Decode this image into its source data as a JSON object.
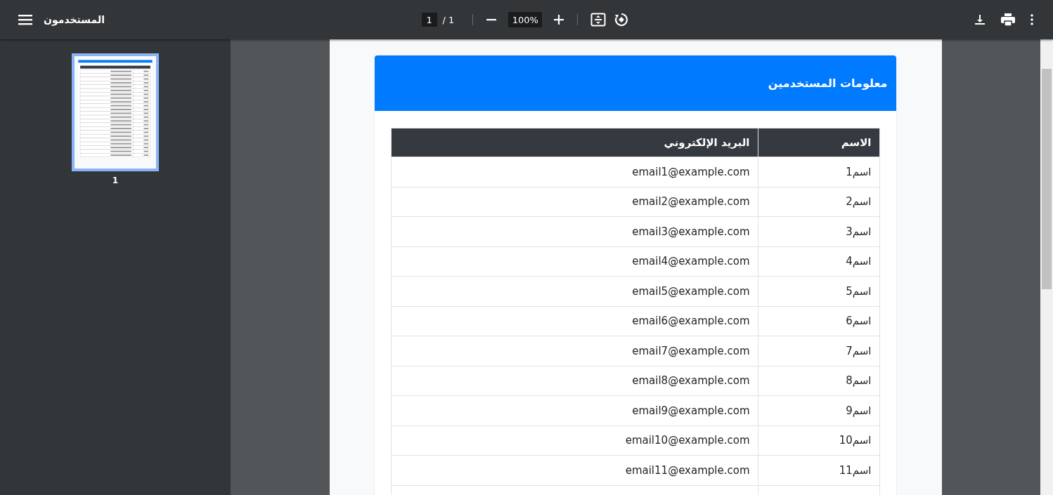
{
  "toolbar": {
    "title": "المستخدمون",
    "page_input": "1",
    "page_total": "/ 1",
    "zoom": "100%"
  },
  "thumbnails": [
    {
      "label": "1",
      "selected": true
    }
  ],
  "document": {
    "card_title": "معلومات المستخدمين",
    "table": {
      "columns": [
        "الاسم",
        "البريد الإلكتروني"
      ],
      "rows": [
        [
          "اسم1",
          "email1@example.com"
        ],
        [
          "اسم2",
          "email2@example.com"
        ],
        [
          "اسم3",
          "email3@example.com"
        ],
        [
          "اسم4",
          "email4@example.com"
        ],
        [
          "اسم5",
          "email5@example.com"
        ],
        [
          "اسم6",
          "email6@example.com"
        ],
        [
          "اسم7",
          "email7@example.com"
        ],
        [
          "اسم8",
          "email8@example.com"
        ],
        [
          "اسم9",
          "email9@example.com"
        ],
        [
          "اسم10",
          "email10@example.com"
        ],
        [
          "اسم11",
          "email11@example.com"
        ]
      ]
    }
  }
}
